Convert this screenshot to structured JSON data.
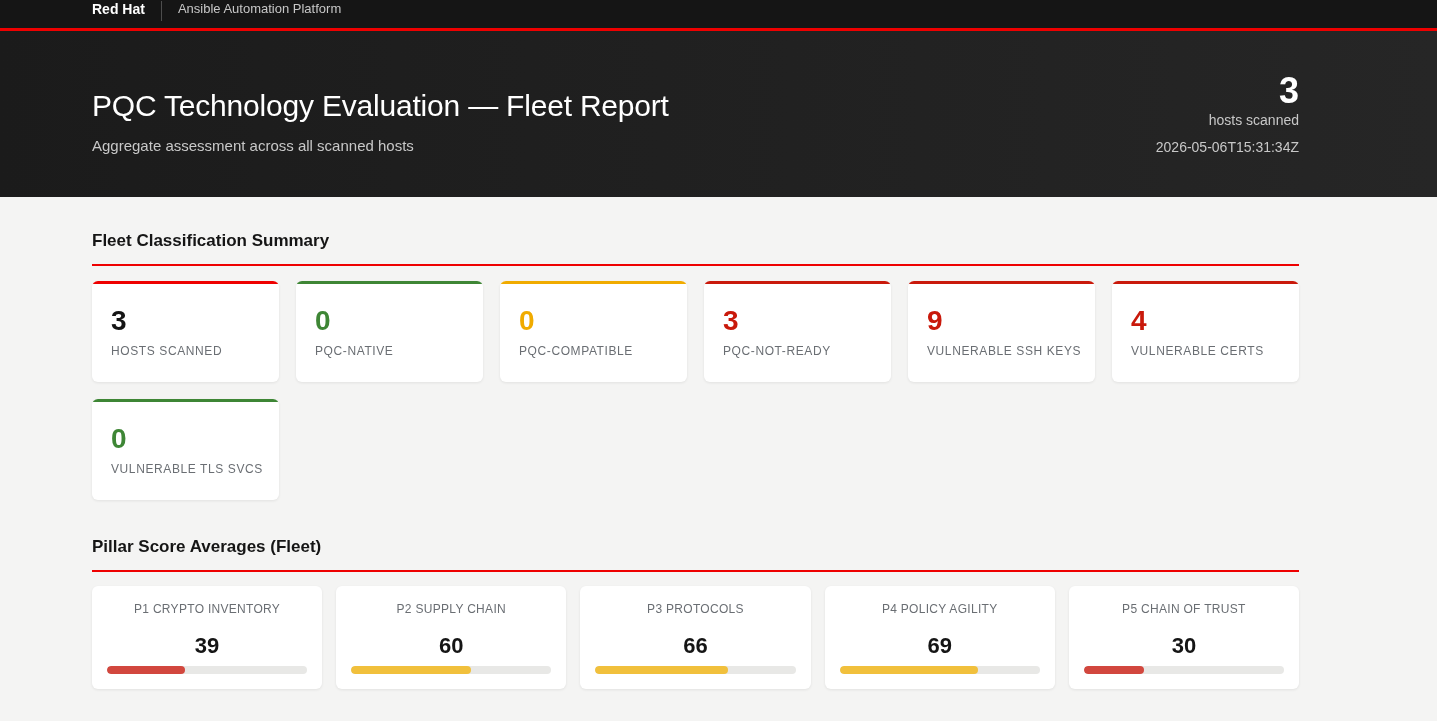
{
  "top_nav": {
    "brand": "Red Hat",
    "product": "Ansible Automation Platform"
  },
  "header": {
    "title": "PQC Technology Evaluation — Fleet Report",
    "subtitle": "Aggregate assessment across all scanned hosts",
    "host_count": "3",
    "host_count_label": "hosts scanned",
    "timestamp": "2026-05-06T15:31:34Z"
  },
  "classification_summary": {
    "title": "Fleet Classification Summary",
    "cards": [
      {
        "kind": "total",
        "value": "3",
        "label": "HOSTS SCANNED",
        "color": "#ee0000"
      },
      {
        "kind": "count",
        "value": "0",
        "label": "PQC-NATIVE",
        "color": "#3e8635"
      },
      {
        "kind": "count",
        "value": "0",
        "label": "PQC-COMPATIBLE",
        "color": "#f0ab00"
      },
      {
        "kind": "count",
        "value": "3",
        "label": "PQC-NOT-READY",
        "color": "#c9190b"
      },
      {
        "kind": "count",
        "value": "9",
        "label": "VULNERABLE SSH KEYS",
        "color": "#c9190b"
      },
      {
        "kind": "count",
        "value": "4",
        "label": "VULNERABLE CERTS",
        "color": "#c9190b"
      },
      {
        "kind": "count",
        "value": "0",
        "label": "VULNERABLE TLS SVCS",
        "color": "#3e8635"
      }
    ]
  },
  "pillar_averages": {
    "title": "Pillar Score Averages (Fleet)",
    "pillars": [
      {
        "label": "P1 CRYPTO INVENTORY",
        "score": "39",
        "level": 0.39,
        "color": "#d2473e"
      },
      {
        "label": "P2 SUPPLY CHAIN",
        "score": "60",
        "level": 0.6,
        "color": "#f1c03c"
      },
      {
        "label": "P3 PROTOCOLS",
        "score": "66",
        "level": 0.66,
        "color": "#f1c03c"
      },
      {
        "label": "P4 POLICY AGILITY",
        "score": "69",
        "level": 0.69,
        "color": "#f1c03c"
      },
      {
        "label": "P5 CHAIN OF TRUST",
        "score": "30",
        "level": 0.3,
        "color": "#d2473e"
      }
    ]
  }
}
